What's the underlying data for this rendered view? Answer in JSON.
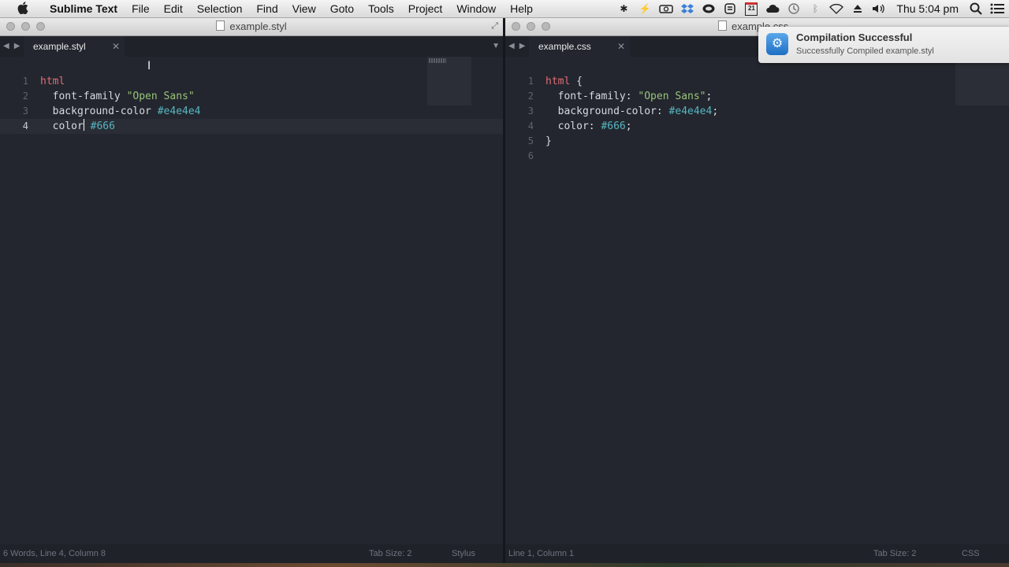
{
  "menubar": {
    "app": "Sublime Text",
    "items": [
      "File",
      "Edit",
      "Selection",
      "Find",
      "View",
      "Goto",
      "Tools",
      "Project",
      "Window",
      "Help"
    ],
    "status_icons": [
      "brightness-icon",
      "network-icon",
      "camera-icon",
      "dropbox-icon",
      "creative-cloud-icon",
      "todo-icon",
      "calendar-icon",
      "cloud-icon",
      "time-machine-icon",
      "bluetooth-icon",
      "wifi-icon",
      "eject-icon",
      "volume-icon"
    ],
    "calendar_day": "21",
    "clock": "Thu 5:04 pm"
  },
  "left": {
    "window_title": "example.styl",
    "tab": "example.styl",
    "lines": [
      {
        "num": "1",
        "tokens": [
          {
            "t": "html",
            "c": "sel"
          }
        ]
      },
      {
        "num": "2",
        "tokens": [
          {
            "t": "  font-family ",
            "c": "prop"
          },
          {
            "t": "\"Open Sans\"",
            "c": "str"
          }
        ]
      },
      {
        "num": "3",
        "tokens": [
          {
            "t": "  background-color ",
            "c": "prop"
          },
          {
            "t": "#e4e4e4",
            "c": "hex"
          }
        ]
      },
      {
        "num": "4",
        "tokens": [
          {
            "t": "  color",
            "c": "prop"
          },
          {
            "t": "CARET",
            "c": "caret"
          },
          {
            "t": " #666",
            "c": "hex"
          }
        ]
      }
    ],
    "current_line": 4,
    "status": {
      "left": "6 Words, Line 4, Column 8",
      "tab_size": "Tab Size: 2",
      "syntax": "Stylus"
    }
  },
  "right": {
    "window_title": "example.css",
    "tab": "example.css",
    "lines": [
      {
        "num": "1",
        "tokens": [
          {
            "t": "html",
            "c": "sel"
          },
          {
            "t": " {",
            "c": "punc"
          }
        ]
      },
      {
        "num": "2",
        "tokens": [
          {
            "t": "  font-family: ",
            "c": "prop"
          },
          {
            "t": "\"Open Sans\"",
            "c": "str"
          },
          {
            "t": ";",
            "c": "punc"
          }
        ]
      },
      {
        "num": "3",
        "tokens": [
          {
            "t": "  background-color: ",
            "c": "prop"
          },
          {
            "t": "#e4e4e4",
            "c": "hex"
          },
          {
            "t": ";",
            "c": "punc"
          }
        ]
      },
      {
        "num": "4",
        "tokens": [
          {
            "t": "  color: ",
            "c": "prop"
          },
          {
            "t": "#666",
            "c": "hex"
          },
          {
            "t": ";",
            "c": "punc"
          }
        ]
      },
      {
        "num": "5",
        "tokens": [
          {
            "t": "}",
            "c": "punc"
          }
        ]
      },
      {
        "num": "6",
        "tokens": []
      }
    ],
    "status": {
      "left": "Line 1, Column 1",
      "tab_size": "Tab Size: 2",
      "syntax": "CSS"
    }
  },
  "notification": {
    "title": "Compilation Successful",
    "body": "Successfully Compiled example.styl"
  },
  "colors": {
    "editor_bg": "#23262e",
    "selector": "#e06c75",
    "string": "#98c379",
    "hex_value": "#56b6c2"
  }
}
